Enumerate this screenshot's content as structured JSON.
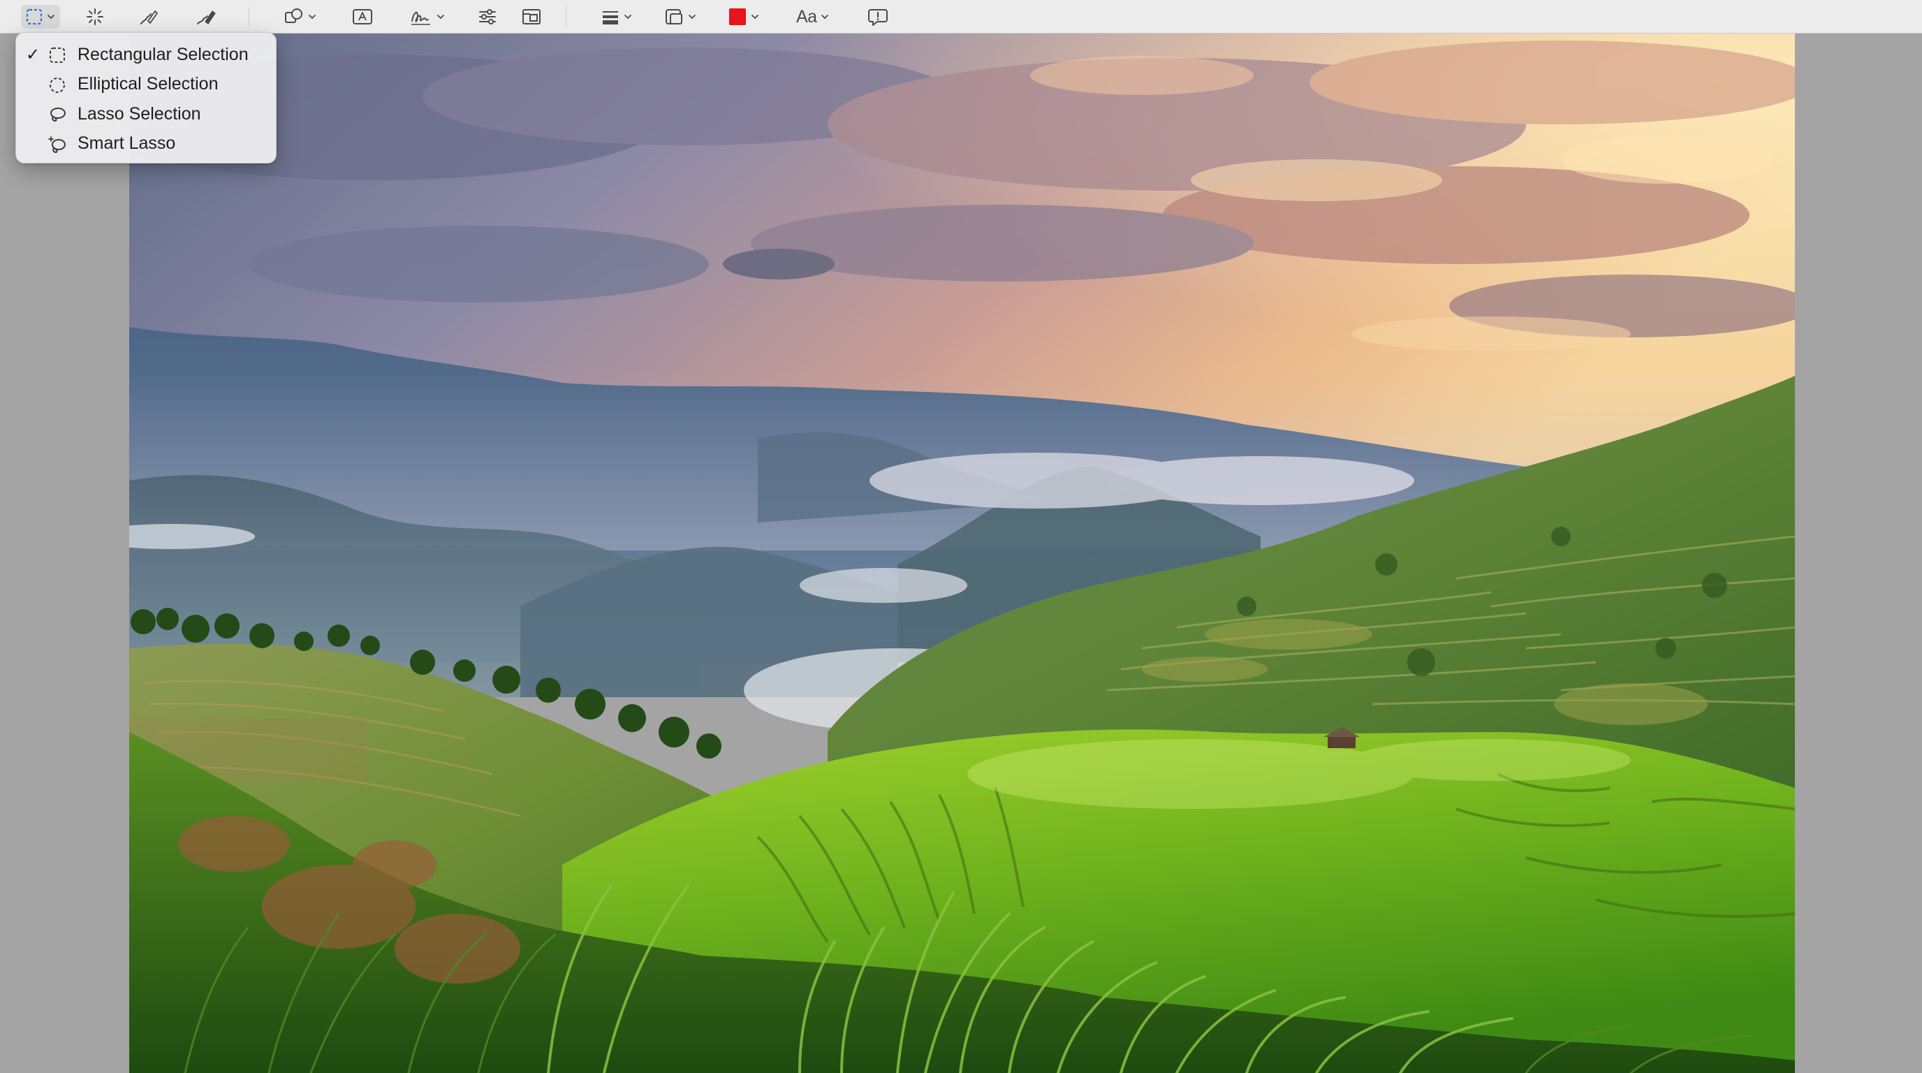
{
  "toolbar": {
    "items": [
      {
        "name": "selection-tools-button",
        "icon": "dashed-rectangle-icon",
        "has_menu": true,
        "active": true
      },
      {
        "name": "instant-alpha-button",
        "icon": "magic-wand-icon",
        "has_menu": false
      },
      {
        "name": "sketch-button",
        "icon": "sketch-pen-icon",
        "has_menu": false
      },
      {
        "name": "draw-button",
        "icon": "draw-pen-icon",
        "has_menu": false
      },
      {
        "name": "shapes-button",
        "icon": "shapes-icon",
        "has_menu": true
      },
      {
        "name": "text-button",
        "icon": "text-box-icon",
        "has_menu": false
      },
      {
        "name": "sign-button",
        "icon": "signature-icon",
        "has_menu": true
      },
      {
        "name": "adjust-color-button",
        "icon": "sliders-icon",
        "has_menu": false
      },
      {
        "name": "adjust-size-button",
        "icon": "resize-icon",
        "has_menu": false
      },
      {
        "name": "shape-style-button",
        "icon": "line-weight-icon",
        "has_menu": true
      },
      {
        "name": "border-color-button",
        "icon": "border-color-icon",
        "has_menu": true
      },
      {
        "name": "fill-color-button",
        "icon": "color-swatch-icon",
        "has_menu": true
      },
      {
        "name": "text-style-button",
        "icon": "text-style-icon",
        "has_menu": true
      },
      {
        "name": "description-button",
        "icon": "speech-bubble-icon",
        "has_menu": false
      }
    ],
    "text_style_label": "Aa",
    "fill_color": "#e8141b"
  },
  "selection_menu": {
    "items": [
      {
        "label": "Rectangular Selection",
        "icon": "dashed-rectangle-icon",
        "checked": true
      },
      {
        "label": "Elliptical Selection",
        "icon": "dashed-ellipse-icon",
        "checked": false
      },
      {
        "label": "Lasso Selection",
        "icon": "lasso-icon",
        "checked": false
      },
      {
        "label": "Smart Lasso",
        "icon": "smart-lasso-icon",
        "checked": false
      }
    ],
    "checkmark": "✓"
  },
  "colors": {
    "toolbar_bg": "#ececec",
    "canvas_bg": "#a4a4a4",
    "icon": "#4a4a4a",
    "selection_accent": "#2f6fd6"
  }
}
